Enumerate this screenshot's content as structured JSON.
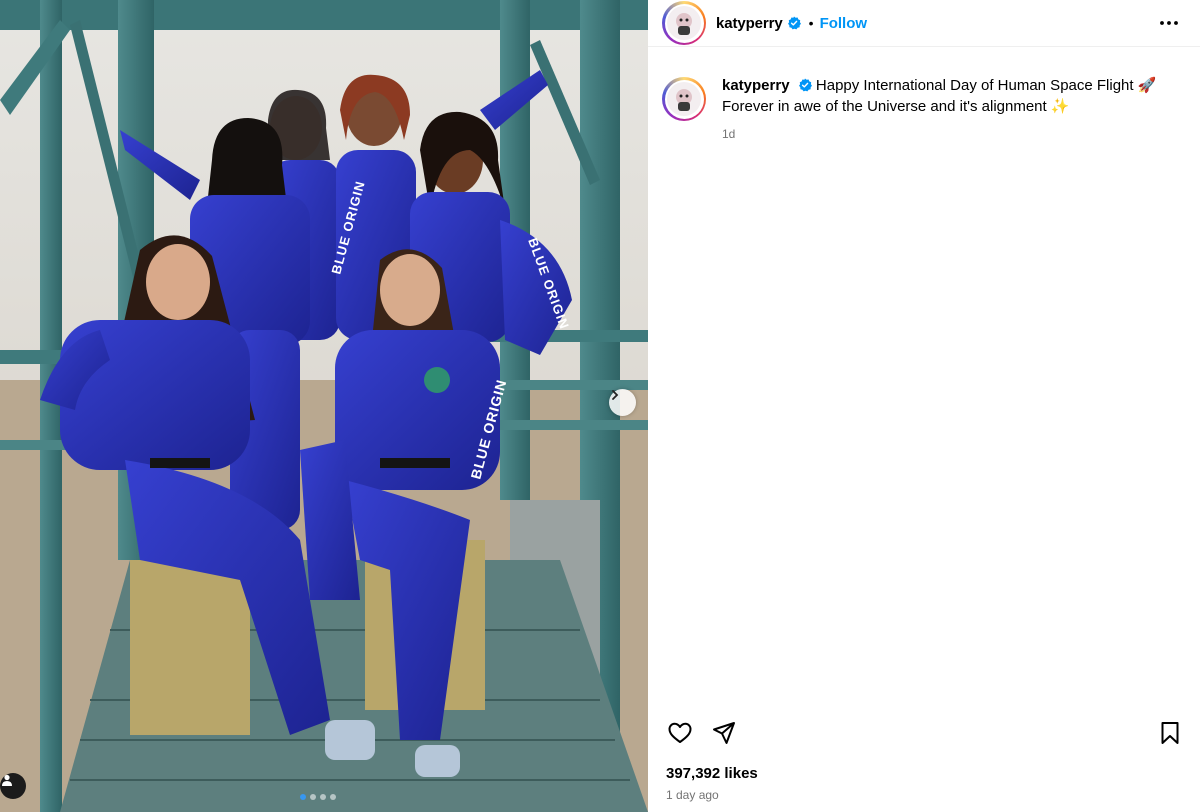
{
  "post": {
    "username": "katyperry",
    "follow_label": "Follow",
    "separator": "•",
    "caption_line1": "Happy International Day of Human Space Flight 🚀",
    "caption_line2": "Forever in awe of the Universe and it's alignment ✨",
    "caption_age": "1d",
    "likes": "397,392 likes",
    "posted_ago": "1 day ago"
  },
  "photo": {
    "suit_text": "BLUE ORIGIN",
    "carousel": {
      "total_dots": 4,
      "active_index": 0
    }
  },
  "icons": {
    "verified": "verified-badge-icon",
    "more": "more-options-icon",
    "like": "heart-icon",
    "share": "paper-plane-icon",
    "save": "bookmark-icon",
    "next": "chevron-right-icon",
    "tag": "person-tag-icon"
  },
  "colors": {
    "follow": "#0095f6",
    "verified": "#0095f6",
    "suit": "#2b33b8",
    "meta_text": "#737373"
  }
}
